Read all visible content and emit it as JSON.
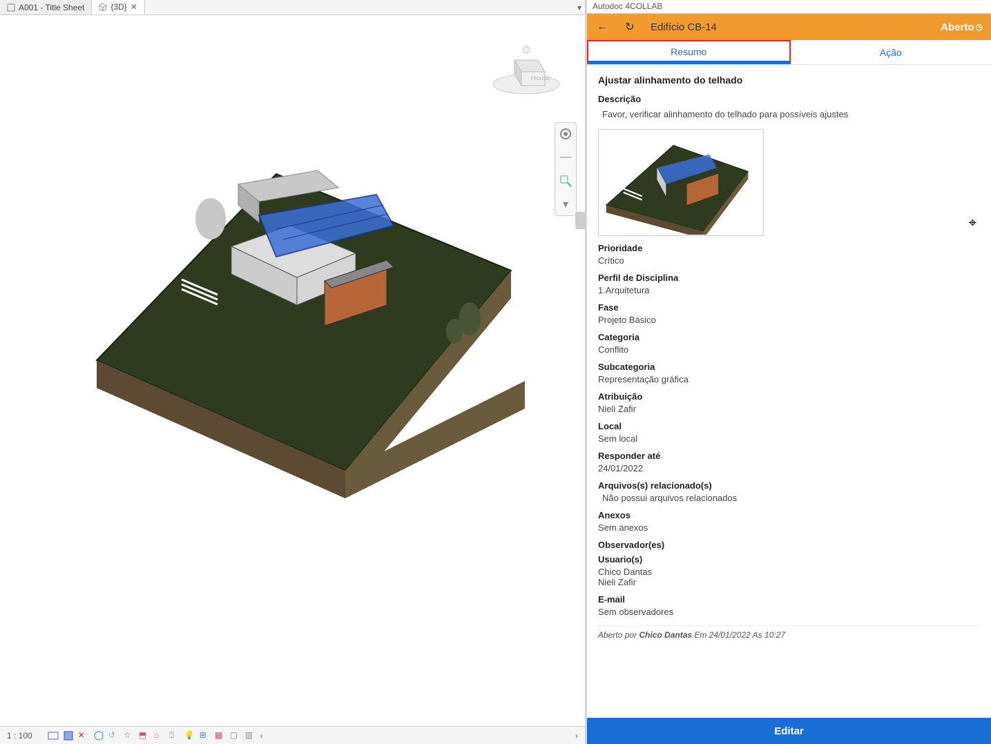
{
  "tabs": {
    "left": {
      "label": "A001 - Title Sheet"
    },
    "active": {
      "label": "{3D}"
    }
  },
  "status": {
    "scale": "1 : 100"
  },
  "panel": {
    "app_title": "Autodoc 4COLLAB",
    "model_title": "Edifício CB-14",
    "state": "Aberto",
    "tabs": {
      "summary": "Resumo",
      "action": "Ação"
    },
    "issue_title": "Ajustar alinhamento do telhado",
    "desc_label": "Descrição",
    "desc_text": "Favor, verificar alinhamento do telhado para possíveis ajustes",
    "priority_label": "Prioridade",
    "priority_value": "Crítico",
    "discipline_label": "Perfil de Disciplina",
    "discipline_value": "1.Arquitetura",
    "phase_label": "Fase",
    "phase_value": "Projeto Básico",
    "category_label": "Categoria",
    "category_value": "Conflito",
    "subcategory_label": "Subcategoria",
    "subcategory_value": "Representação gráfica",
    "assigned_label": "Atribuição",
    "assigned_value": "Nieli Zafir",
    "location_label": "Local",
    "location_value": "Sem local",
    "respond_label": "Responder até",
    "respond_value": "24/01/2022",
    "files_label": "Arquivos(s) relacionado(s)",
    "files_value": "Não possui arquivos relacionados",
    "attachments_label": "Anexos",
    "attachments_value": "Sem anexos",
    "observers_label": "Observador(es)",
    "users_label": "Usuario(s)",
    "user1": "Chico Dantas",
    "user2": "Nieli Zafir",
    "email_label": "E-mail",
    "email_value": "Sem observadores",
    "audit_prefix": "Aberto por ",
    "audit_name": "Chico Dantas",
    "audit_suffix": " Em 24/01/2022 As 10:27",
    "edit_button": "Editar"
  }
}
